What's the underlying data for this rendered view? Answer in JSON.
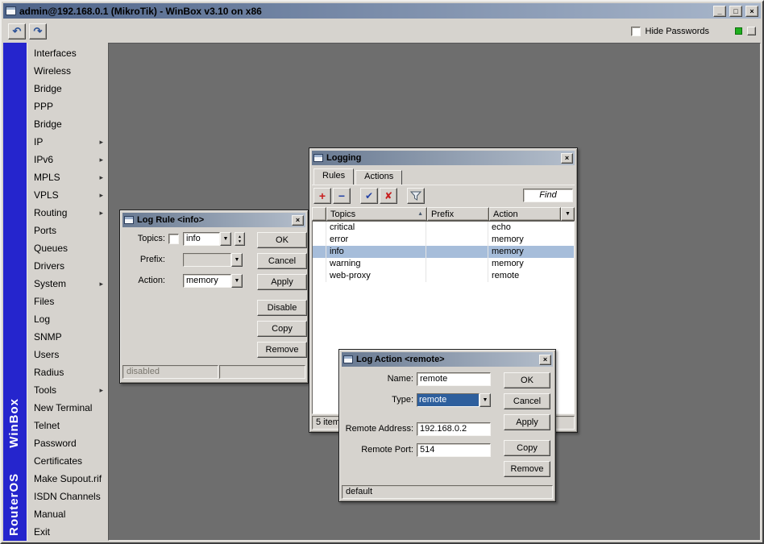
{
  "window": {
    "title": "admin@192.168.0.1 (MikroTik) - WinBox v3.10 on x86"
  },
  "toolbar": {
    "hide_passwords": "Hide Passwords"
  },
  "icons": {
    "undo": "↶",
    "redo": "↷",
    "minimize": "_",
    "maximize": "□",
    "close": "×",
    "add": "+",
    "remove": "−",
    "enable": "✔",
    "disable": "✘",
    "dropdown": "▼",
    "sort_asc": "▲",
    "submenu": "▸",
    "spinner_up": "▲",
    "spinner_down": "▼"
  },
  "colors": {
    "brand_blue": "#2525cd",
    "workspace_gray": "#6e6e6e",
    "row_selection": "#a6bdda",
    "text_selection": "#2e5f9d",
    "indicator_green": "#1fae1f"
  },
  "sidebar": {
    "brand": "RouterOS WinBox",
    "items": [
      {
        "label": "Interfaces",
        "submenu": false
      },
      {
        "label": "Wireless",
        "submenu": false
      },
      {
        "label": "Bridge",
        "submenu": false
      },
      {
        "label": "PPP",
        "submenu": false
      },
      {
        "label": "Bridge",
        "submenu": false
      },
      {
        "label": "IP",
        "submenu": true
      },
      {
        "label": "IPv6",
        "submenu": true
      },
      {
        "label": "MPLS",
        "submenu": true
      },
      {
        "label": "VPLS",
        "submenu": true
      },
      {
        "label": "Routing",
        "submenu": true
      },
      {
        "label": "Ports",
        "submenu": false
      },
      {
        "label": "Queues",
        "submenu": false
      },
      {
        "label": "Drivers",
        "submenu": false
      },
      {
        "label": "System",
        "submenu": true
      },
      {
        "label": "Files",
        "submenu": false
      },
      {
        "label": "Log",
        "submenu": false
      },
      {
        "label": "SNMP",
        "submenu": false
      },
      {
        "label": "Users",
        "submenu": false
      },
      {
        "label": "Radius",
        "submenu": false
      },
      {
        "label": "Tools",
        "submenu": true
      },
      {
        "label": "New Terminal",
        "submenu": false
      },
      {
        "label": "Telnet",
        "submenu": false
      },
      {
        "label": "Password",
        "submenu": false
      },
      {
        "label": "Certificates",
        "submenu": false
      },
      {
        "label": "Make Supout.rif",
        "submenu": false
      },
      {
        "label": "ISDN Channels",
        "submenu": false
      },
      {
        "label": "Manual",
        "submenu": false
      },
      {
        "label": "Exit",
        "submenu": false
      }
    ]
  },
  "logging": {
    "title": "Logging",
    "tabs": [
      "Rules",
      "Actions"
    ],
    "find_placeholder": "Find",
    "columns": {
      "topics": "Topics",
      "prefix": "Prefix",
      "action": "Action"
    },
    "rows": [
      {
        "topics": "critical",
        "prefix": "",
        "action": "echo"
      },
      {
        "topics": "error",
        "prefix": "",
        "action": "memory"
      },
      {
        "topics": "info",
        "prefix": "",
        "action": "memory"
      },
      {
        "topics": "warning",
        "prefix": "",
        "action": "memory"
      },
      {
        "topics": "web-proxy",
        "prefix": "",
        "action": "remote"
      }
    ],
    "selected_row": "info",
    "status": "5 items"
  },
  "log_rule": {
    "title": "Log Rule <info>",
    "labels": {
      "topics": "Topics:",
      "prefix": "Prefix:",
      "action": "Action:"
    },
    "values": {
      "topics": "info",
      "prefix": "",
      "action": "memory"
    },
    "buttons": {
      "ok": "OK",
      "cancel": "Cancel",
      "apply": "Apply",
      "disable": "Disable",
      "copy": "Copy",
      "remove": "Remove"
    },
    "status": "disabled"
  },
  "log_action": {
    "title": "Log Action <remote>",
    "labels": {
      "name": "Name:",
      "type": "Type:",
      "remote_address": "Remote Address:",
      "remote_port": "Remote Port:"
    },
    "values": {
      "name": "remote",
      "type": "remote",
      "remote_address": "192.168.0.2",
      "remote_port": "514"
    },
    "buttons": {
      "ok": "OK",
      "cancel": "Cancel",
      "apply": "Apply",
      "copy": "Copy",
      "remove": "Remove"
    },
    "status": "default"
  }
}
